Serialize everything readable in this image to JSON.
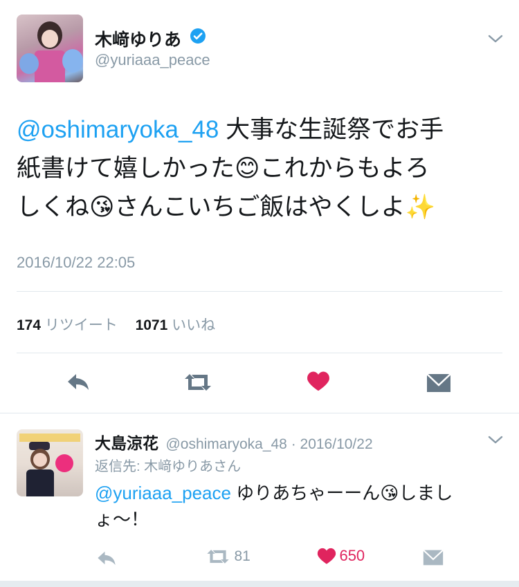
{
  "main_tweet": {
    "display_name": "木﨑ゆりあ",
    "handle": "@yuriaaa_peace",
    "mention": "@oshimaryoka_48",
    "text_line1": "大事な生誕祭でお手",
    "text_line2a": "紙書けて嬉しかった",
    "emoji_smile": "😊",
    "text_line2b": "これからもよろ",
    "text_line3a": "しくね",
    "emoji_kiss": "😘",
    "text_line3b": "さんこいちご飯はやくしよ",
    "emoji_sparkles": "✨",
    "timestamp": "2016/10/22 22:05",
    "retweet_count": "174",
    "retweet_label": "リツイート",
    "like_count": "1071",
    "like_label": "いいね"
  },
  "reply": {
    "display_name": "大島涼花",
    "handle_date": "@oshimaryoka_48 · 2016/10/22",
    "reply_to": "返信先: 木﨑ゆりあさん",
    "mention": "@yuriaaa_peace",
    "text_a": "ゆりあちゃーーん",
    "emoji_kiss": "😘",
    "text_b": "しまし",
    "text_line2": "ょ〜！",
    "retweet_count": "81",
    "like_count": "650"
  },
  "colors": {
    "link": "#1da1f2",
    "muted": "#8899a6",
    "like": "#e0245e",
    "verified": "#1da1f2",
    "icon": "#657786"
  }
}
